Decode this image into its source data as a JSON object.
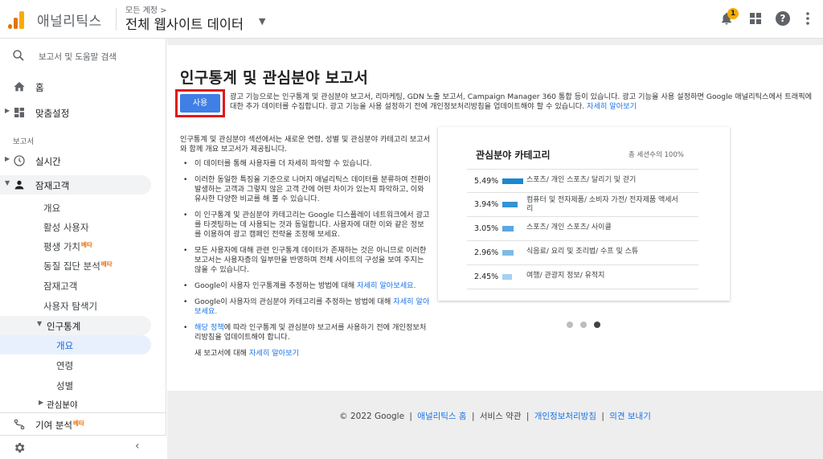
{
  "header": {
    "brand": "애널리틱스",
    "account_crumb": "모든 계정 >",
    "view_title": "전체 웹사이트 데이터",
    "notifications_count": "1",
    "icons": [
      "notifications-icon",
      "apps-grid-icon",
      "help-icon",
      "more-vert-icon"
    ]
  },
  "sidebar": {
    "search_placeholder": "보고서 및 도움말 검색",
    "home": "홈",
    "customize": "맞춤설정",
    "reports_section": "보고서",
    "realtime": "실시간",
    "audience": "잠재고객",
    "audience_items": [
      "개요",
      "활성 사용자",
      "평생 가치",
      "동질 집단 분석",
      "잠재고객",
      "사용자 탐색기"
    ],
    "beta": "베타",
    "demographics": "인구통계",
    "demographics_items": [
      "개요",
      "연령",
      "성별"
    ],
    "interests": "관심분야",
    "attribution": "기여 분석"
  },
  "main": {
    "title": "인구통계 및 관심분야 보고서",
    "enable_button": "사용",
    "notice_text": "광고 기능으로는 인구통계 및 관심분야 보고서, 리마케팅, GDN 노출 보고서, Campaign Manager 360 통합 등이 있습니다. 광고 기능을 사용 설정하면 Google 애널리틱스에서 트래픽에 대한 추가 데이터를 수집합니다. 광고 기능을 사용 설정하기 전에 개인정보처리방침을 업데이트해야 할 수 있습니다.",
    "notice_link": "자세히 알아보기",
    "intro": "인구통계 및 관심분야 섹션에서는 새로운 연령, 성별 및 관심분야 카테고리 보고서와 함께 개요 보고서가 제공됩니다.",
    "bullets": [
      {
        "text": "이 데이터를 통해 사용자를 더 자세히 파악할 수 있습니다.",
        "link": ""
      },
      {
        "text": "이러한 동일한 특징을 기준으로 나머지 애널리틱스 데이터를 분류하여 전환이 발생하는 고객과 그렇지 않은 고객 간에 어떤 차이가 있는지 파악하고, 이와 유사한 다양한 비교를 해 볼 수 있습니다.",
        "link": ""
      },
      {
        "text": "이 인구통계 및 관심분야 카테고리는 Google 디스플레이 네트워크에서 광고를 타겟팅하는 데 사용되는 것과 동일합니다. 사용자에 대한 이와 같은 정보를 이용하여 광고 캠페인 전략을 조정해 보세요.",
        "link": ""
      },
      {
        "text": "모든 사용자에 대해 관련 인구통계 데이터가 존재하는 것은 아니므로 이러한 보고서는 사용자층의 일부만을 반영하며 전체 사이트의 구성을 보여 주지는 않을 수 있습니다.",
        "link": ""
      },
      {
        "text": "Google이 사용자 인구통계를 추정하는 방법에 대해 ",
        "link": "자세히 알아보세요."
      },
      {
        "text": "Google이 사용자의 관심분야 카테고리를 추정하는 방법에 대해 ",
        "link": "자세히 알아보세요."
      },
      {
        "text": "에 따라 인구통계 및 관심분야 보고서를 사용하기 전에 개인정보처리방침을 업데이트해야 합니다.",
        "link": "해당 정책",
        "link_first": true
      }
    ],
    "learn_prefix": "새 보고서에 대해 ",
    "learn_link": "자세히 알아보기"
  },
  "chart_data": {
    "type": "bar",
    "title": "관심분야 카테고리",
    "subtitle": "총 세션수의 100%",
    "categories": [
      "스포츠/ 개인 스포츠/ 달리기 및 걷기",
      "컴퓨터 및 전자제품/ 소비자 가전/ 전자제품 액세서리",
      "스포츠/ 개인 스포츠/ 사이클",
      "식음료/ 요리 및 조리법/ 수프 및 스튜",
      "여행/ 관광지 정보/ 유적지"
    ],
    "values": [
      5.49,
      3.94,
      3.05,
      2.96,
      2.45
    ],
    "labels": [
      "5.49%",
      "3.94%",
      "3.05%",
      "2.96%",
      "2.45%"
    ],
    "colors": [
      "#1c87d1",
      "#3593d6",
      "#5aa7e0",
      "#7fbbe8",
      "#a6d1f0"
    ],
    "carousel_pages": 3,
    "carousel_active": 3
  },
  "footer": {
    "copyright": "© 2022 Google",
    "links": [
      "애널리틱스 홈",
      "서비스 약관",
      "개인정보처리방침",
      "의견 보내기"
    ]
  }
}
